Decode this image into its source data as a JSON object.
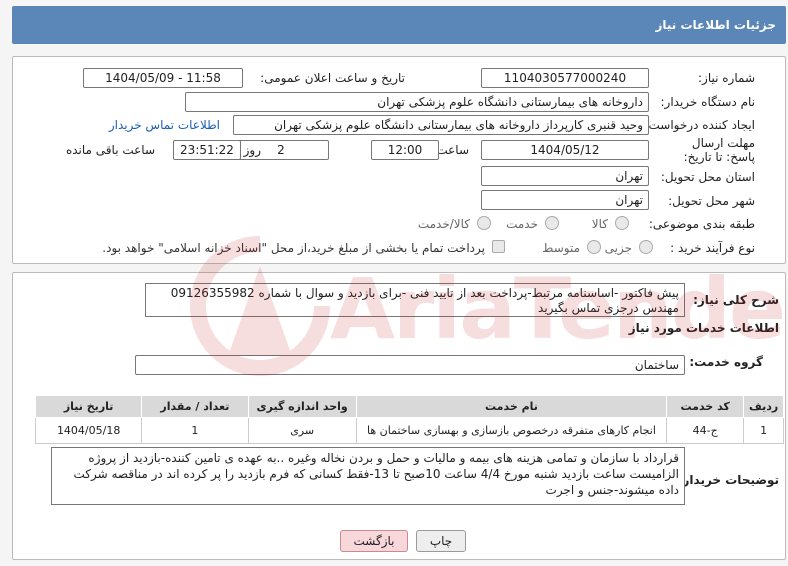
{
  "header": {
    "title": "جزئیات اطلاعات نیاز"
  },
  "form": {
    "need_number_label": "شماره نیاز:",
    "need_number": "1104030577000240",
    "announce_label": "تاریخ و ساعت اعلان عمومی:",
    "announce_value": "1404/05/09 - 11:58",
    "buyer_org_label": "نام دستگاه خریدار:",
    "buyer_org": "داروخانه های بیمارستانی دانشگاه علوم پزشکی تهران",
    "creator_label": "ایجاد کننده درخواست:",
    "creator": "وحید قنبری کارپرداز داروخانه های بیمارستانی دانشگاه علوم پزشکی تهران",
    "contact_link": "اطلاعات تماس خریدار",
    "deadline_label": "مهلت ارسال پاسخ: تا تاریخ:",
    "deadline_date": "1404/05/12",
    "time_label": "ساعت",
    "deadline_time": "12:00",
    "days_value": "2",
    "days_label": "روز و",
    "remaining_time": "23:51:22",
    "remaining_label": "ساعت باقی مانده",
    "province_label": "استان محل تحویل:",
    "province": "تهران",
    "city_label": "شهر محل تحویل:",
    "city": "تهران",
    "category_label": "طبقه بندی موضوعی:",
    "category_options": [
      "کالا",
      "خدمت",
      "کالا/خدمت"
    ],
    "process_label": "نوع فرآیند خرید :",
    "process_options": [
      "جزیی",
      "متوسط"
    ],
    "payment_note": "پرداخت تمام یا بخشی از مبلغ خرید،از محل \"اسناد خزانه اسلامی\" خواهد بود."
  },
  "need_desc": {
    "label": "شرح کلی نیاز:",
    "text": "پیش فاکتور -اساسنامه مرتبط-پرداخت بعد از تایید فنی -برای بازدید و سوال با شماره 09126355982 مهندس درجزی تماس بگیرید"
  },
  "services": {
    "section_title": "اطلاعات خدمات مورد نیاز",
    "group_label": "گروه خدمت:",
    "group_value": "ساختمان",
    "columns": [
      "ردیف",
      "کد خدمت",
      "نام خدمت",
      "واحد اندازه گیری",
      "تعداد / مقدار",
      "تاریخ نیاز"
    ],
    "rows": [
      [
        "1",
        "ج-44",
        "انجام کارهای متفرقه درخصوص بازسازی و بهسازی ساختمان ها",
        "سری",
        "1",
        "1404/05/18"
      ]
    ]
  },
  "buyer_notes": {
    "label": "توضیحات خریدار:",
    "text": "قرارداد با سازمان و تمامی هزینه های بیمه و مالیات و حمل و بردن نخاله وغیره ..به عهده ی تامین کننده-بازدید از پروژه الزامیست ساعت بازدید شنبه مورخ 4/4 ساعت 10صبح تا 13-فقط کسانی که فرم بازدید را پر کرده اند در مناقصه شرکت داده میشوند-جنس و اجرت"
  },
  "buttons": {
    "print": "چاپ",
    "back": "بازگشت"
  },
  "watermark": {
    "text": "AriaTender.neT"
  },
  "colors": {
    "header": "#5b86b8",
    "link": "#1a5fb4",
    "back_button": "#f8d7da"
  }
}
